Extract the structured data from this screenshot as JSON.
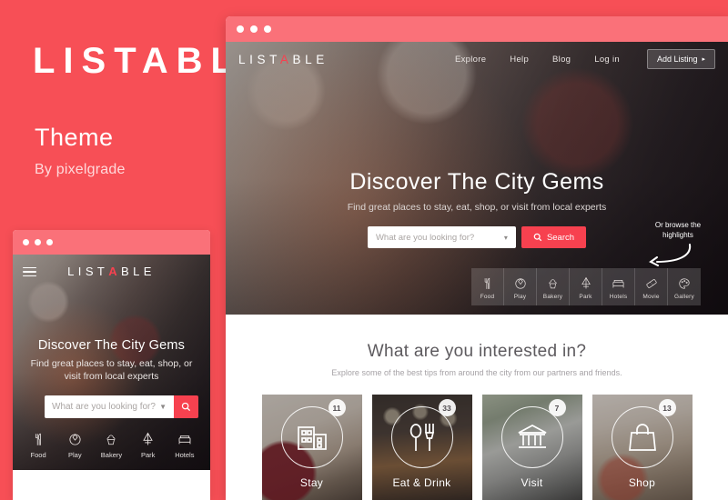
{
  "promo": {
    "title": "LISTABLE",
    "subtitle": "Theme",
    "author": "By pixelgrade",
    "accent_color": "#f74f56",
    "chrome_color": "#fa7179",
    "cta_color": "#f7414f"
  },
  "mobile": {
    "logo_pre": "LIST",
    "logo_accent": "A",
    "logo_post": "BLE",
    "hero_title": "Discover The City Gems",
    "hero_sub": "Find great places to stay, eat, shop, or visit from local experts",
    "search_placeholder": "What are you looking for?",
    "menu_icon": "hamburger-icon",
    "search_icon": "search-icon",
    "categories": [
      {
        "label": "Food",
        "icon": "fork-knife-icon"
      },
      {
        "label": "Play",
        "icon": "ball-icon"
      },
      {
        "label": "Bakery",
        "icon": "cupcake-icon"
      },
      {
        "label": "Park",
        "icon": "tree-icon"
      },
      {
        "label": "Hotels",
        "icon": "bed-icon"
      }
    ]
  },
  "browser": {
    "nav": {
      "logo_pre": "LIST",
      "logo_accent": "A",
      "logo_post": "BLE",
      "links": [
        {
          "label": "Explore"
        },
        {
          "label": "Help"
        },
        {
          "label": "Blog"
        },
        {
          "label": "Log in"
        }
      ],
      "cta_label": "Add Listing",
      "cta_caret": "▸"
    },
    "hero": {
      "title": "Discover The City Gems",
      "subtitle": "Find great places to stay, eat, shop, or visit from local experts",
      "select_value": "What are you looking for?",
      "select_caret": "▾",
      "search_label": "Search",
      "search_icon": "search-icon",
      "browse_note": "Or browse the highlights",
      "browse_arrow_icon": "curved-arrow-left-icon",
      "categories": [
        {
          "label": "Food",
          "icon": "fork-knife-icon"
        },
        {
          "label": "Play",
          "icon": "ball-icon"
        },
        {
          "label": "Bakery",
          "icon": "cupcake-icon"
        },
        {
          "label": "Park",
          "icon": "tree-icon"
        },
        {
          "label": "Hotels",
          "icon": "bed-icon"
        },
        {
          "label": "Movie",
          "icon": "ticket-icon"
        },
        {
          "label": "Gallery",
          "icon": "palette-icon"
        }
      ]
    },
    "interest": {
      "title": "What are you interested in?",
      "subtitle": "Explore some of the best tips from around the city from our partners and friends.",
      "cards": [
        {
          "label": "Stay",
          "count": "11",
          "icon": "building-icon"
        },
        {
          "label": "Eat & Drink",
          "count": "33",
          "icon": "spoon-fork-icon"
        },
        {
          "label": "Visit",
          "count": "7",
          "icon": "museum-icon"
        },
        {
          "label": "Shop",
          "count": "13",
          "icon": "shopping-bag-icon"
        }
      ]
    }
  }
}
